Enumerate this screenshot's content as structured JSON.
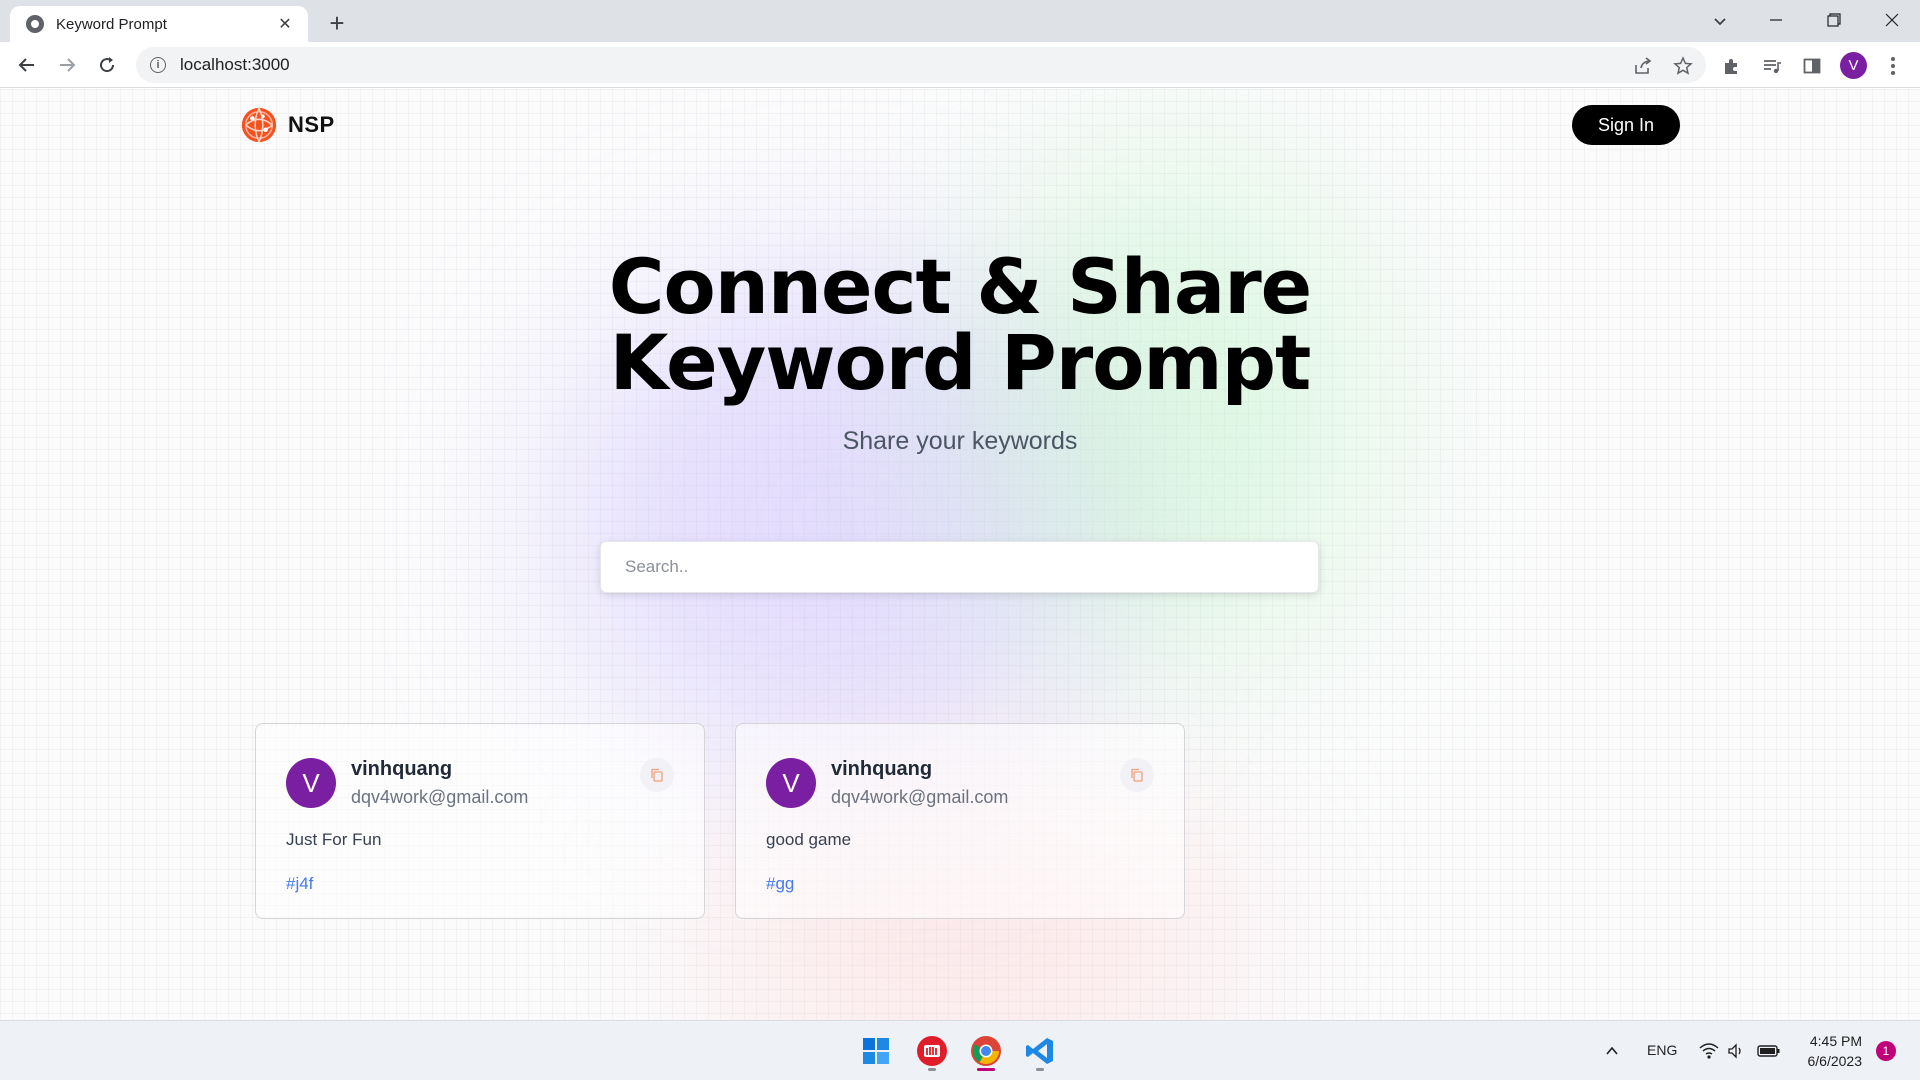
{
  "browser": {
    "tab_title": "Keyword Prompt",
    "new_tab_label": "+",
    "url": "localhost:3000",
    "profile_initial": "V"
  },
  "header": {
    "logo_text": "NSP",
    "signin_label": "Sign In"
  },
  "hero": {
    "title_line1": "Connect & Share",
    "title_line2": "Keyword Prompt",
    "subtitle": "Share your keywords"
  },
  "search": {
    "placeholder": "Search..",
    "value": ""
  },
  "cards": [
    {
      "avatar_initial": "V",
      "username": "vinhquang",
      "email": "dqv4work@gmail.com",
      "prompt": "Just For Fun",
      "tag": "#j4f"
    },
    {
      "avatar_initial": "V",
      "username": "vinhquang",
      "email": "dqv4work@gmail.com",
      "prompt": "good game",
      "tag": "#gg"
    }
  ],
  "taskbar": {
    "language": "ENG",
    "time": "4:45 PM",
    "date": "6/6/2023",
    "notification_count": "1"
  },
  "colors": {
    "accent": "#7b1fa2",
    "tag_blue": "#2563eb",
    "logo_orange": "#f4511e"
  }
}
